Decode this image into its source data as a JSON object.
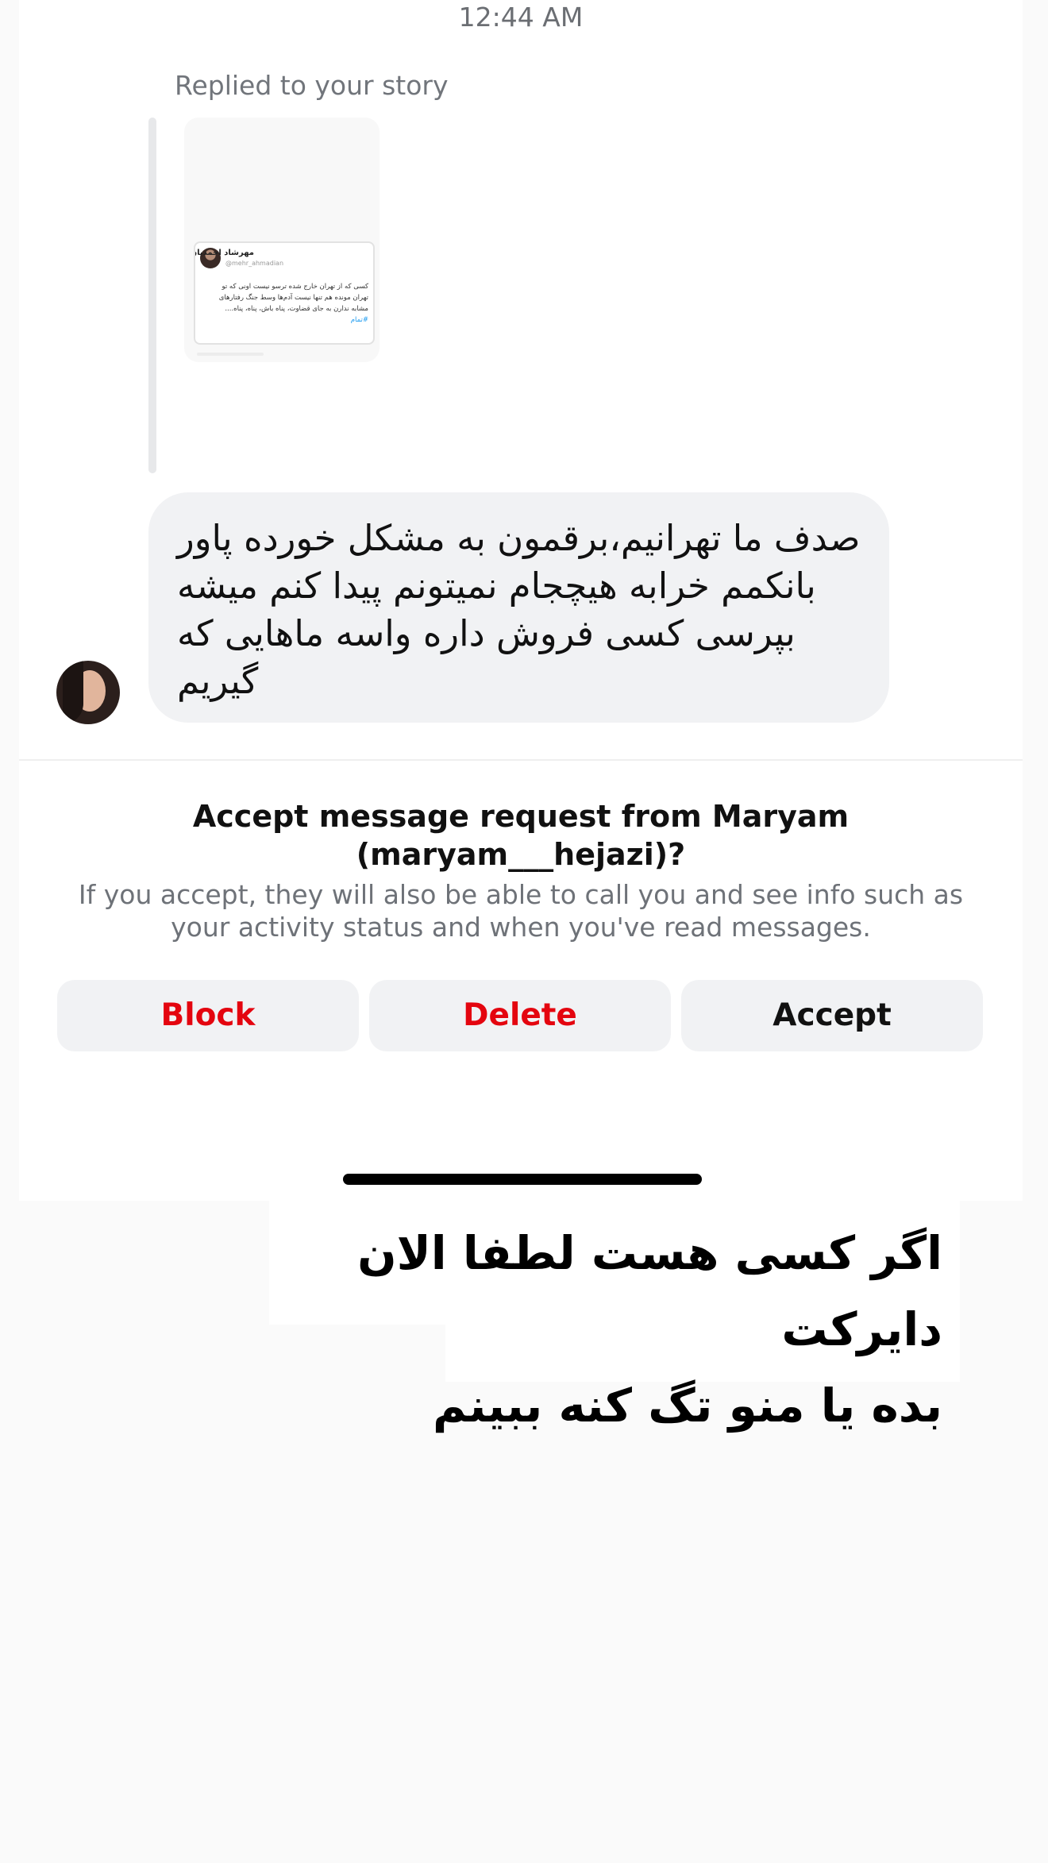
{
  "header": {
    "timestamp": "12:44 AM"
  },
  "story_reply": {
    "label": "Replied to your story",
    "story": {
      "author_name": "مهرشاد احمدیان",
      "author_handle": "@mehr_ahmadian",
      "text": "کسی که از تهران خارج شده ترسو نیست اونی که تو تهران مونده هم تنها نیست آدم‌ها وسط جنگ رفتارهای مشابه ندارن به جای قضاوت، پناه باش، پناه، پناه....",
      "tag": "#تمام"
    }
  },
  "message": {
    "text": "صدف ما تهرانیم،برقمون به مشکل خورده پاور بانکمم خرابه هیچجام نمیتونم پیدا کنم میشه بپرسی کسی فروش داره واسه ماهایی که گیریم"
  },
  "request": {
    "title_line1": "Accept message request from Maryam",
    "title_line2": "(maryam___hejazi)?",
    "body": "If you accept, they will also be able to call you and see info such as your activity status and when you've read messages.",
    "buttons": {
      "block": "Block",
      "delete": "Delete",
      "accept": "Accept"
    }
  },
  "caption": {
    "line1": "اگر کسی هست لطفا الان دایرکت",
    "line2": "بده یا منو تگ کنه ببینم"
  },
  "colors": {
    "danger": "#e4050f",
    "bubble": "#f1f2f4",
    "muted_text": "#6e7278"
  }
}
